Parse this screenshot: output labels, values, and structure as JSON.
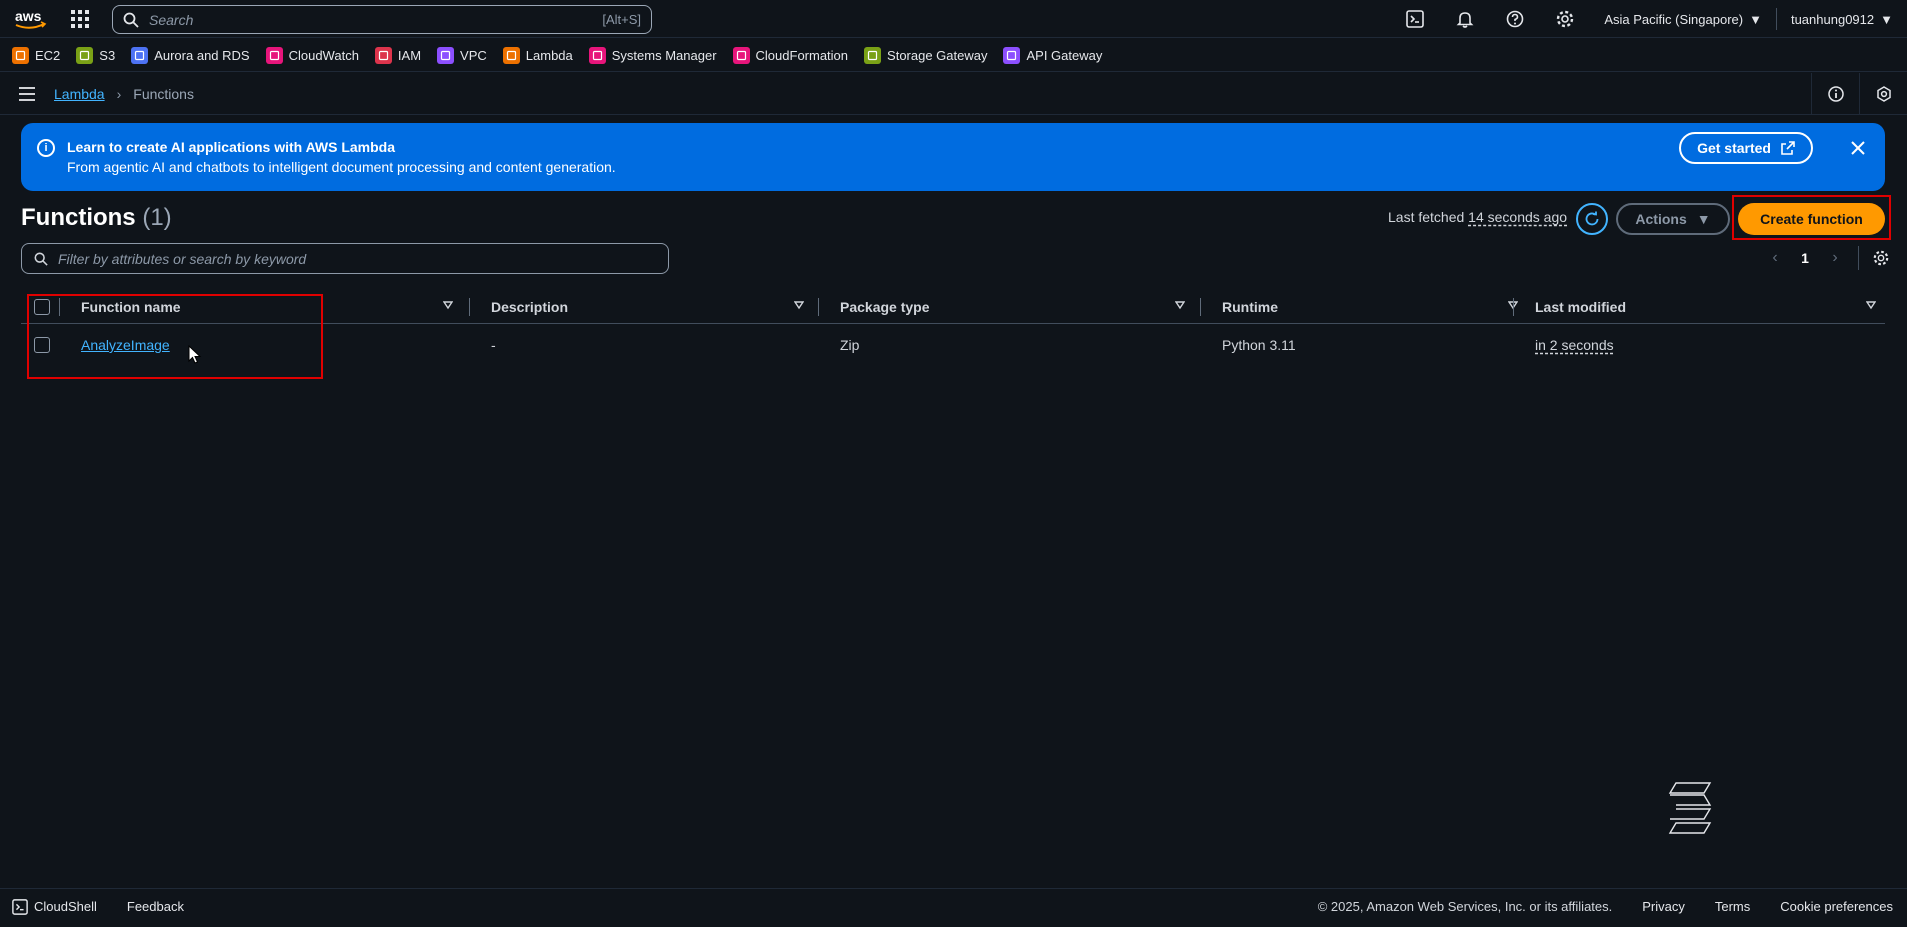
{
  "topnav": {
    "logo_text": "aws",
    "search_placeholder": "Search",
    "search_shortcut": "[Alt+S]",
    "region": "Asia Pacific (Singapore)",
    "user": "tuanhung0912"
  },
  "favorites": [
    {
      "label": "EC2",
      "color": "#ed7100"
    },
    {
      "label": "S3",
      "color": "#7aa116"
    },
    {
      "label": "Aurora and RDS",
      "color": "#4d72f3"
    },
    {
      "label": "CloudWatch",
      "color": "#e7157b"
    },
    {
      "label": "IAM",
      "color": "#dd344c"
    },
    {
      "label": "VPC",
      "color": "#8c4fff"
    },
    {
      "label": "Lambda",
      "color": "#ed7100"
    },
    {
      "label": "Systems Manager",
      "color": "#e7157b"
    },
    {
      "label": "CloudFormation",
      "color": "#e7157b"
    },
    {
      "label": "Storage Gateway",
      "color": "#7aa116"
    },
    {
      "label": "API Gateway",
      "color": "#8c4fff"
    }
  ],
  "breadcrumb": {
    "root": "Lambda",
    "current": "Functions"
  },
  "banner": {
    "title": "Learn to create AI applications with AWS Lambda",
    "subtitle": "From agentic AI and chatbots to intelligent document processing and content generation.",
    "button": "Get started"
  },
  "header": {
    "title": "Functions",
    "count": "(1)",
    "last_fetched_label": "Last fetched",
    "last_fetched_value": "14 seconds ago",
    "actions_label": "Actions",
    "create_label": "Create function"
  },
  "filter": {
    "placeholder": "Filter by attributes or search by keyword"
  },
  "pagination": {
    "page": "1"
  },
  "table": {
    "columns": [
      "Function name",
      "Description",
      "Package type",
      "Runtime",
      "Last modified"
    ],
    "rows": [
      {
        "name": "AnalyzeImage",
        "description": "-",
        "package_type": "Zip",
        "runtime": "Python 3.11",
        "last_modified": "in 2 seconds"
      }
    ]
  },
  "footer": {
    "cloudshell": "CloudShell",
    "feedback": "Feedback",
    "copyright": "© 2025, Amazon Web Services, Inc. or its affiliates.",
    "privacy": "Privacy",
    "terms": "Terms",
    "cookies": "Cookie preferences"
  },
  "colors": {
    "accent_link": "#42b4ff",
    "primary_button": "#ff9900",
    "banner_bg": "#006ce0",
    "highlight_box": "#e00000"
  }
}
